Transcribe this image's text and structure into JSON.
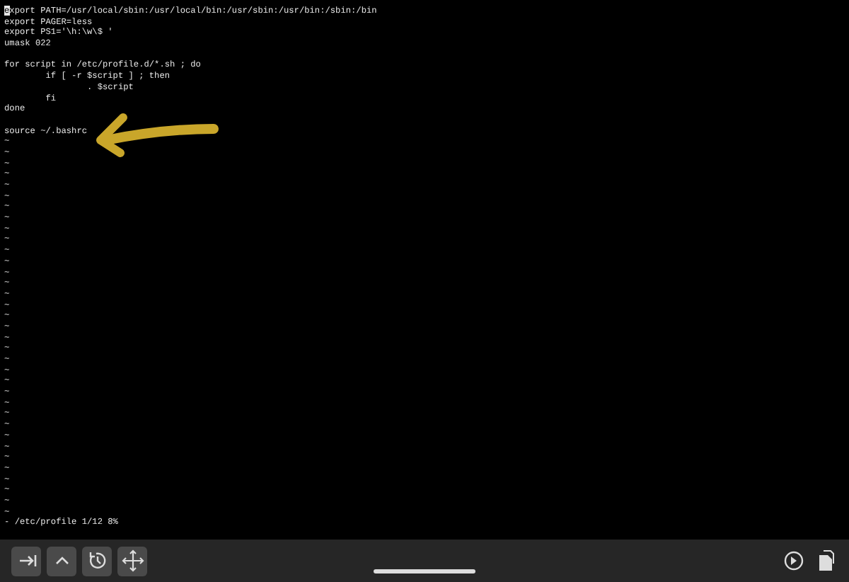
{
  "terminal": {
    "lines": [
      {
        "kind": "text",
        "text": "export PATH=/usr/local/sbin:/usr/local/bin:/usr/sbin:/usr/bin:/sbin:/bin",
        "cursor": true
      },
      {
        "kind": "text",
        "text": "export PAGER=less",
        "cursor": false
      },
      {
        "kind": "text",
        "text": "export PS1='\\h:\\w\\$ '",
        "cursor": false
      },
      {
        "kind": "text",
        "text": "umask 022",
        "cursor": false
      },
      {
        "kind": "blank"
      },
      {
        "kind": "text",
        "text": "for script in /etc/profile.d/*.sh ; do",
        "cursor": false
      },
      {
        "kind": "text",
        "text": "\tif [ -r $script ] ; then",
        "cursor": false
      },
      {
        "kind": "text",
        "text": "\t\t. $script",
        "cursor": false
      },
      {
        "kind": "text",
        "text": "\tfi",
        "cursor": false
      },
      {
        "kind": "text",
        "text": "done",
        "cursor": false
      },
      {
        "kind": "blank"
      },
      {
        "kind": "text",
        "text": "source ~/.bashrc",
        "cursor": false
      },
      {
        "kind": "tilde",
        "text": "~"
      },
      {
        "kind": "tilde",
        "text": "~"
      },
      {
        "kind": "tilde",
        "text": "~"
      },
      {
        "kind": "tilde",
        "text": "~"
      },
      {
        "kind": "tilde",
        "text": "~"
      },
      {
        "kind": "tilde",
        "text": "~"
      },
      {
        "kind": "tilde",
        "text": "~"
      },
      {
        "kind": "tilde",
        "text": "~"
      },
      {
        "kind": "tilde",
        "text": "~"
      },
      {
        "kind": "tilde",
        "text": "~"
      },
      {
        "kind": "tilde",
        "text": "~"
      },
      {
        "kind": "tilde",
        "text": "~"
      },
      {
        "kind": "tilde",
        "text": "~"
      },
      {
        "kind": "tilde",
        "text": "~"
      },
      {
        "kind": "tilde",
        "text": "~"
      },
      {
        "kind": "tilde",
        "text": "~"
      },
      {
        "kind": "tilde",
        "text": "~"
      },
      {
        "kind": "tilde",
        "text": "~"
      },
      {
        "kind": "tilde",
        "text": "~"
      },
      {
        "kind": "tilde",
        "text": "~"
      },
      {
        "kind": "tilde",
        "text": "~"
      },
      {
        "kind": "tilde",
        "text": "~"
      },
      {
        "kind": "tilde",
        "text": "~"
      },
      {
        "kind": "tilde",
        "text": "~"
      },
      {
        "kind": "tilde",
        "text": "~"
      },
      {
        "kind": "tilde",
        "text": "~"
      },
      {
        "kind": "tilde",
        "text": "~"
      },
      {
        "kind": "tilde",
        "text": "~"
      },
      {
        "kind": "tilde",
        "text": "~"
      },
      {
        "kind": "tilde",
        "text": "~"
      },
      {
        "kind": "tilde",
        "text": "~"
      },
      {
        "kind": "tilde",
        "text": "~"
      },
      {
        "kind": "tilde",
        "text": "~"
      },
      {
        "kind": "tilde",
        "text": "~"
      },
      {
        "kind": "tilde",
        "text": "~"
      }
    ],
    "status_line": "- /etc/profile 1/12 8%"
  },
  "toolbar": {
    "left_buttons": [
      {
        "kind": "tab"
      },
      {
        "kind": "control"
      },
      {
        "kind": "history"
      },
      {
        "kind": "move"
      }
    ],
    "right_buttons": [
      {
        "kind": "settings"
      },
      {
        "kind": "paste"
      }
    ]
  }
}
